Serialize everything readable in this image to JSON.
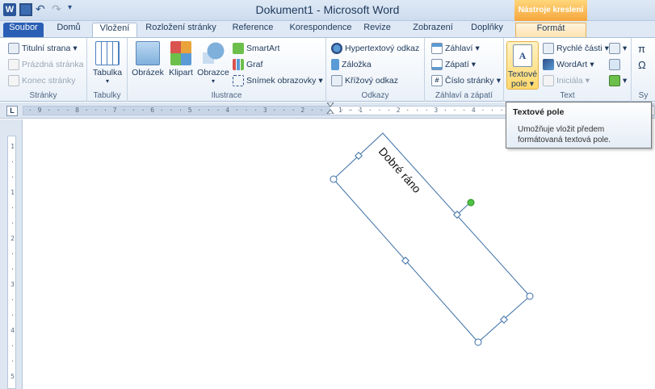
{
  "window": {
    "title": "Dokument1  -  Microsoft Word",
    "context_tab_group": "Nástroje kreslení",
    "app_icon": "W"
  },
  "tabs": {
    "file": "Soubor",
    "home": "Domů",
    "insert": "Vložení",
    "layout": "Rozložení stránky",
    "references": "Reference",
    "mailings": "Korespondence",
    "review": "Revize",
    "view": "Zobrazení",
    "addins": "Doplňky",
    "format": "Formát"
  },
  "ribbon": {
    "pages": {
      "label": "Stránky",
      "cover": "Titulní strana",
      "blank": "Prázdná stránka",
      "break": "Konec stránky"
    },
    "tables": {
      "label": "Tabulky",
      "table": "Tabulka"
    },
    "illustrations": {
      "label": "Ilustrace",
      "picture": "Obrázek",
      "clipart": "Klipart",
      "shapes": "Obrazce",
      "smartart": "SmartArt",
      "chart": "Graf",
      "screenshot": "Snímek obrazovky"
    },
    "links": {
      "label": "Odkazy",
      "hyperlink": "Hypertextový odkaz",
      "bookmark": "Záložka",
      "crossref": "Křížový odkaz"
    },
    "header_footer": {
      "label": "Záhlaví a zápatí",
      "header": "Záhlaví",
      "footer": "Zápatí",
      "page_number": "Číslo stránky"
    },
    "text": {
      "label": "Text",
      "textbox_line1": "Textové",
      "textbox_line2": "pole",
      "quickparts": "Rychlé části",
      "wordart": "WordArt",
      "dropcap": "Iniciála"
    },
    "symbols": {
      "label": "Sy"
    }
  },
  "ruler": {
    "left_numbers": "· 9 · · · 8 · · · 7 · · · 6 · · · 5 · · · 4 · · · 3 · · · 2 · · · 1 · ·",
    "right_numbers": "· · 1 · · · 2 · · · 3 · · · 4 · · · 5 · · · 6 · · · 7 · · ·",
    "vertical_numbers": [
      "1",
      "·",
      "·",
      "1",
      "·",
      "·",
      "2",
      "·",
      "·",
      "3",
      "·",
      "·",
      "4",
      "·",
      "·",
      "5"
    ]
  },
  "tooltip": {
    "title": "Textové pole",
    "body_line1": "Umožňuje vložit předem",
    "body_line2": "formátovaná textová pole."
  },
  "document": {
    "textbox_text": "Dobré ráno"
  },
  "colors": {
    "file_tab": "#2b5fb5",
    "drawing_tools": "#f6a53c",
    "selection": "#3c6fa6",
    "rotate_handle": "#4fc443"
  }
}
